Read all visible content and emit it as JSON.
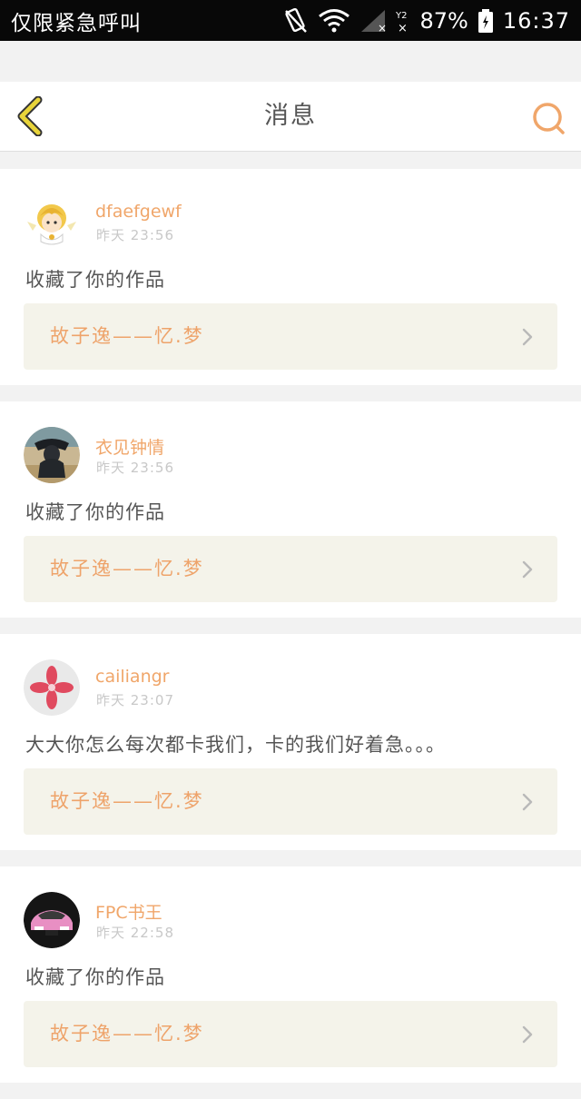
{
  "status_bar": {
    "carrier_text": "仅限紧急呼叫",
    "battery": "87%",
    "time": "16:37",
    "sim_label": "Y2"
  },
  "header": {
    "title": "消息",
    "back_icon": "chevron-left-icon",
    "search_icon": "search-icon"
  },
  "colors": {
    "accent": "#f0a66a",
    "back_arrow": "#e8d43a",
    "card_bg": "#f4f3ea"
  },
  "messages": [
    {
      "username": "dfaefgewf",
      "time": "昨天 23:56",
      "text": "收藏了你的作品",
      "work_title": "故子逸——忆.梦",
      "avatar": "cartoon-avatar"
    },
    {
      "username": "衣见钟情",
      "time": "昨天 23:56",
      "text": "收藏了你的作品",
      "work_title": "故子逸——忆.梦",
      "avatar": "photo-avatar"
    },
    {
      "username": "cailiangr",
      "time": "昨天 23:07",
      "text": "大大你怎么每次都卡我们，卡的我们好着急。。。",
      "work_title": "故子逸——忆.梦",
      "avatar": "flower-avatar"
    },
    {
      "username": "FPC书王",
      "time": "昨天 22:58",
      "text": "收藏了你的作品",
      "work_title": "故子逸——忆.梦",
      "avatar": "car-avatar"
    }
  ]
}
